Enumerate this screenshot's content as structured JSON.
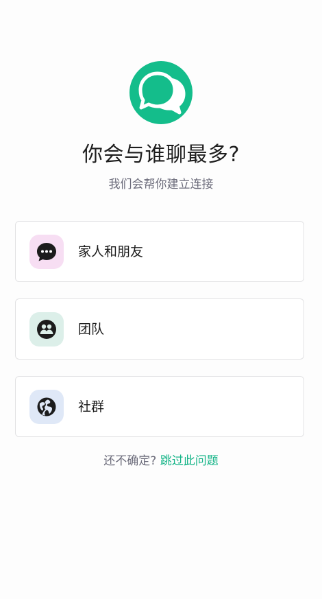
{
  "colors": {
    "brand": "#14bd8b",
    "skip_link": "#14b487",
    "family_icon_bg": "#f7def3",
    "team_icon_bg": "#dcefe9",
    "community_icon_bg": "#dfe8f7"
  },
  "header": {
    "logo_icon": "chat-bubbles-icon",
    "title": "你会与谁聊最多?",
    "subtitle": "我们会帮你建立连接"
  },
  "options": [
    {
      "label": "家人和朋友",
      "icon": "chat-dots-icon"
    },
    {
      "label": "团队",
      "icon": "team-icon"
    },
    {
      "label": "社群",
      "icon": "globe-icon"
    }
  ],
  "footer": {
    "question": "还不确定?",
    "skip_label": "跳过此问题"
  }
}
